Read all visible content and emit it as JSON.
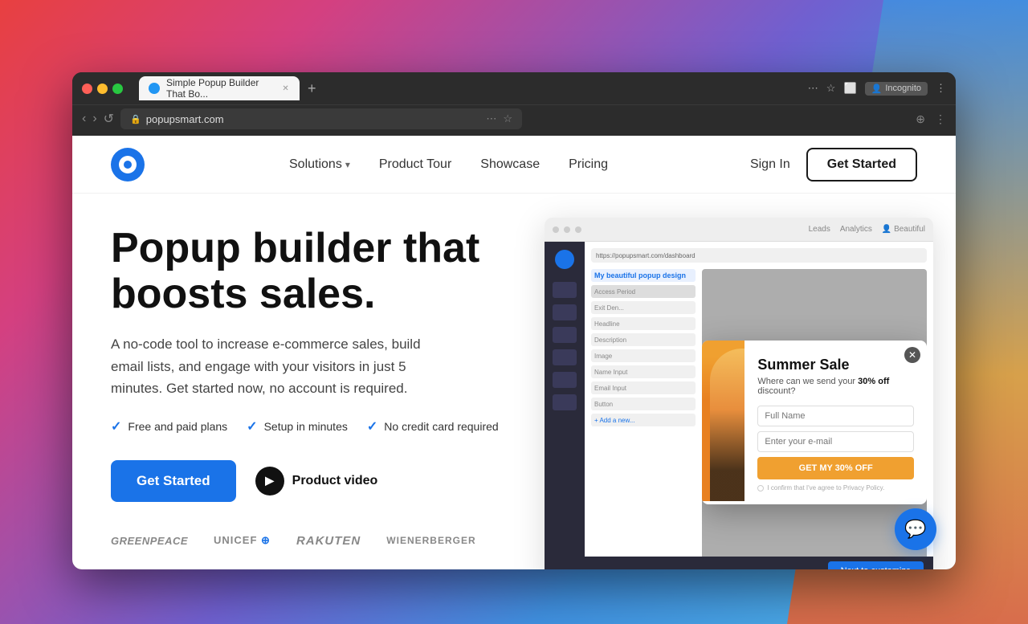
{
  "desktop": {
    "bg_description": "macOS desktop with colorful gradient"
  },
  "browser": {
    "tab": {
      "title": "Simple Popup Builder That Bo...",
      "favicon_alt": "popupsmart favicon"
    },
    "address_bar": {
      "url": "popupsmart.com",
      "lock_icon": "lock"
    },
    "controls": {
      "back": "‹",
      "forward": "›",
      "reload": "↺",
      "new_tab": "+",
      "incognito_label": "Incognito",
      "ellipsis": "⋮"
    }
  },
  "nav": {
    "logo_alt": "Popupsmart logo",
    "solutions_label": "Solutions",
    "product_tour_label": "Product Tour",
    "showcase_label": "Showcase",
    "pricing_label": "Pricing",
    "sign_in_label": "Sign In",
    "get_started_label": "Get Started"
  },
  "hero": {
    "title_line1": "Popup builder that",
    "title_line2": "boosts sales.",
    "subtitle": "A no-code tool to increase e-commerce sales, build email lists, and engage with your visitors in just 5 minutes. Get started now, no account is required.",
    "checks": [
      "Free and paid plans",
      "Setup in minutes",
      "No credit card required"
    ],
    "cta_label": "Get Started",
    "video_label": "Product video"
  },
  "logos": [
    "GREENPEACE",
    "unicef",
    "Rakuten",
    "wienerberger"
  ],
  "popup": {
    "title": "Summer Sale",
    "subtitle_text": "Where can we send your ",
    "discount": "30% off",
    "subtitle_end": " discount?",
    "input1_placeholder": "Full Name",
    "input2_placeholder": "Enter your e-mail",
    "submit_label": "GET MY 30% OFF",
    "privacy_text": "I confirm that I've agree to Privacy Policy."
  },
  "mockup": {
    "url": "https://popupsmart.com/dashboard",
    "nav_items": [
      "Leads",
      "Analytics"
    ],
    "sidebar_items": [
      "Exit Den...",
      "Headline",
      "Descrip...",
      "Email Inpu...",
      "Name Input",
      "Email Input",
      "Button"
    ],
    "bottom_btn": "Next to customize"
  }
}
